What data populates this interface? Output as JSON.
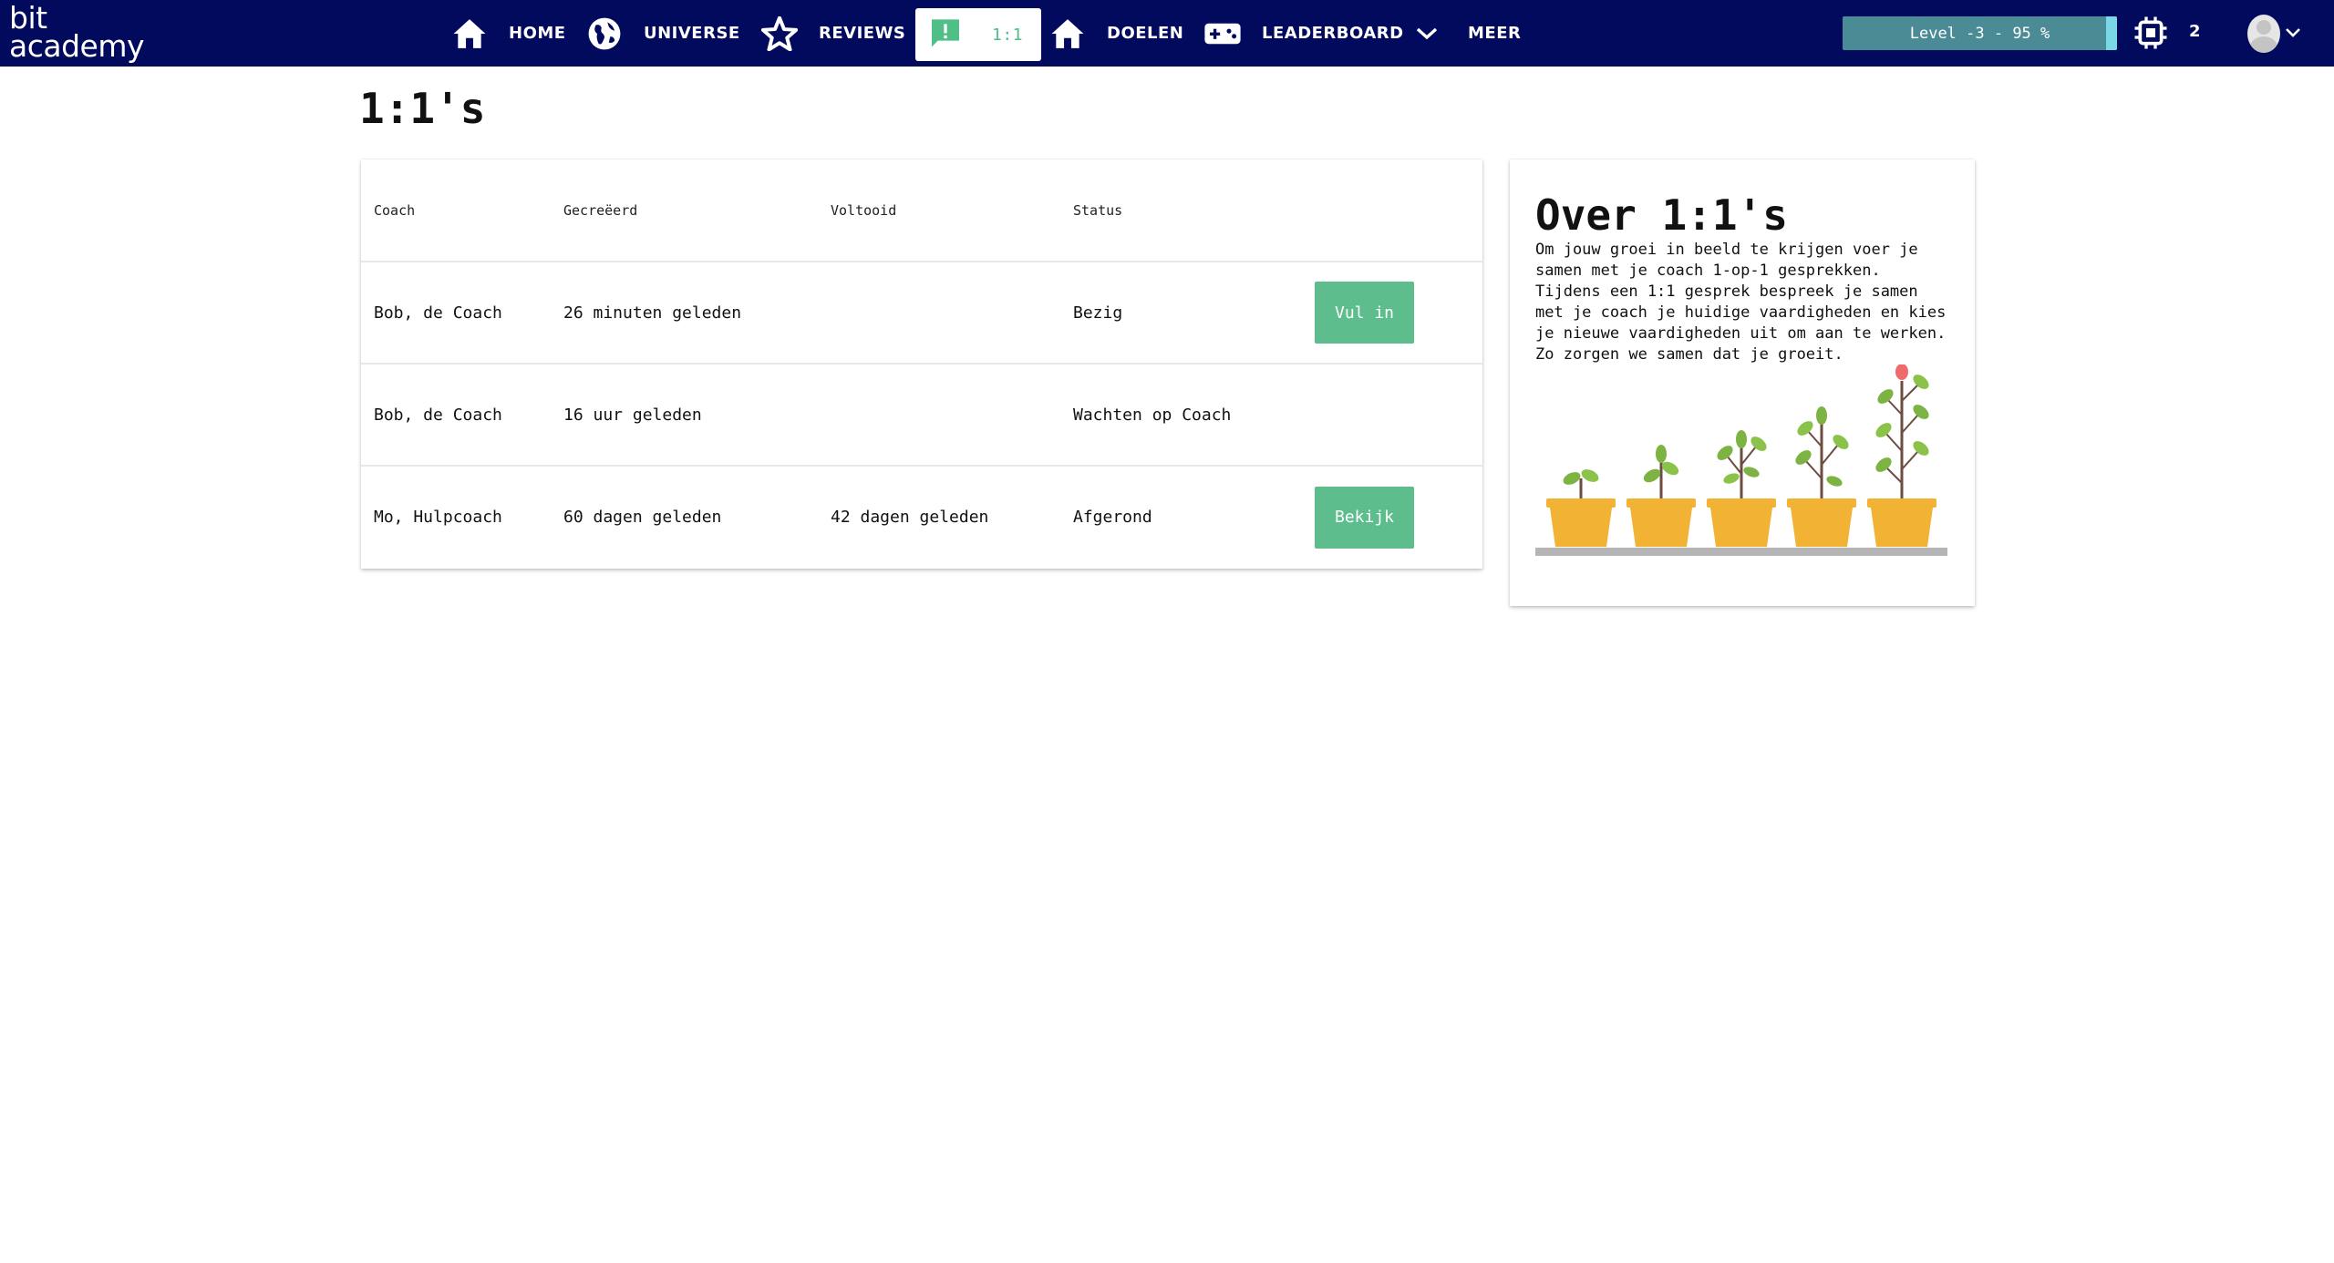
{
  "brand": {
    "logo_line1": "bit",
    "logo_line2": "academy"
  },
  "nav": {
    "items": [
      {
        "label": "HOME",
        "icon": "home-icon"
      },
      {
        "label": "UNIVERSE",
        "icon": "globe-icon"
      },
      {
        "label": "REVIEWS",
        "icon": "star-icon"
      },
      {
        "label": "1:1",
        "icon": "chat-alert-icon",
        "active": true
      },
      {
        "label": "DOELEN",
        "icon": "home-icon"
      },
      {
        "label": "LEADERBOARD",
        "icon": "gamepad-icon"
      },
      {
        "label": "MEER",
        "icon": "chevron-down-icon"
      }
    ],
    "level_text": "Level -3 - 95 %",
    "level_progress": 0.95,
    "chip_count": "2"
  },
  "page": {
    "title": "1:1's"
  },
  "table": {
    "headers": [
      "Coach",
      "Gecreëerd",
      "Voltooid",
      "Status",
      ""
    ],
    "rows": [
      {
        "coach": "Bob, de Coach",
        "created": "26 minuten geleden",
        "completed": "",
        "status": "Bezig",
        "action": "Vul in"
      },
      {
        "coach": "Bob, de Coach",
        "created": "16 uur geleden",
        "completed": "",
        "status": "Wachten op Coach",
        "action": ""
      },
      {
        "coach": "Mo, Hulpcoach",
        "created": "60 dagen geleden",
        "completed": "42 dagen geleden",
        "status": "Afgerond",
        "action": "Bekijk"
      }
    ]
  },
  "info": {
    "title": "Over 1:1's",
    "text": "Om jouw groei in beeld te krijgen voer je samen met je coach 1-op-1 gesprekken. Tijdens een 1:1 gesprek bespreek je samen met je coach je huidige vaardigheden en kies je nieuwe vaardigheden uit om aan te werken. Zo zorgen we samen dat je groeit."
  },
  "colors": {
    "nav_bg": "#020a5e",
    "accent_green": "#5dbd8c",
    "level_bar": "#4a8b96",
    "pot": "#f2b233",
    "leaf": "#7cb342"
  }
}
